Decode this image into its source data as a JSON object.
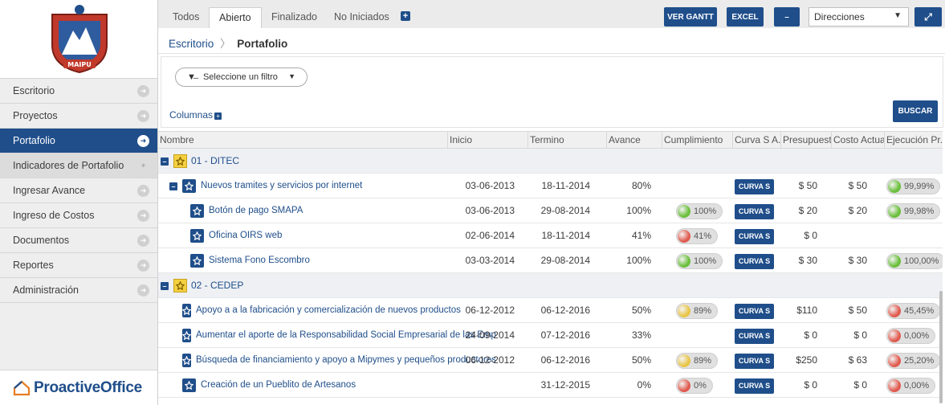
{
  "colors": {
    "primary": "#1f4e8a",
    "green": "#6abf3b",
    "red": "#e05a4e",
    "yellow": "#e8c547"
  },
  "logo": {
    "text": "MAIPU"
  },
  "sidebar": {
    "items": [
      {
        "label": "Escritorio"
      },
      {
        "label": "Proyectos"
      },
      {
        "label": "Portafolio"
      },
      {
        "label": "Indicadores de Portafolio"
      },
      {
        "label": "Ingresar Avance"
      },
      {
        "label": "Ingreso de Costos"
      },
      {
        "label": "Documentos"
      },
      {
        "label": "Reportes"
      },
      {
        "label": "Administración"
      }
    ]
  },
  "brand": {
    "name": "ProactiveOffice"
  },
  "tabs": [
    "Todos",
    "Abierto",
    "Finalizado",
    "No Iniciados"
  ],
  "toolbar": {
    "gantt": "VER GANTT",
    "excel": "EXCEL",
    "minus": "–",
    "select": "Direcciones",
    "expand": "⤢"
  },
  "breadcrumb": {
    "root": "Escritorio",
    "sep": "〉",
    "current": "Portafolio"
  },
  "filter": {
    "placeholder": "Seleccione un filtro",
    "columns": "Columnas",
    "search": "BUSCAR"
  },
  "columns": [
    "Nombre",
    "Inicio",
    "Termino",
    "Avance",
    "Cumplimiento",
    "Curva S A...",
    "Presupuesto...",
    "Costo Actual...",
    "Ejecución Pr..."
  ],
  "curvas_label": "CURVA S",
  "rows": [
    {
      "kind": "group",
      "name": "01 - DITEC"
    },
    {
      "kind": "sub",
      "name": "Nuevos tramites y servicios por internet",
      "inicio": "03-06-2013",
      "termino": "18-11-2014",
      "avance": "80%",
      "cumpl": "",
      "cumpl_color": "",
      "presup": "$ 50",
      "costo": "$ 50",
      "ejec": "99,99%",
      "ejec_color": "green"
    },
    {
      "kind": "item",
      "name": "Botón de pago SMAPA",
      "inicio": "03-06-2013",
      "termino": "29-08-2014",
      "avance": "100%",
      "cumpl": "100%",
      "cumpl_color": "green",
      "presup": "$ 20",
      "costo": "$ 20",
      "ejec": "99,98%",
      "ejec_color": "green"
    },
    {
      "kind": "item",
      "name": "Oficina OIRS web",
      "inicio": "02-06-2014",
      "termino": "18-11-2014",
      "avance": "41%",
      "cumpl": "41%",
      "cumpl_color": "red",
      "presup": "$ 0",
      "costo": "",
      "ejec": "",
      "ejec_color": ""
    },
    {
      "kind": "item",
      "name": "Sistema Fono Escombro",
      "inicio": "03-03-2014",
      "termino": "29-08-2014",
      "avance": "100%",
      "cumpl": "100%",
      "cumpl_color": "green",
      "presup": "$ 30",
      "costo": "$ 30",
      "ejec": "100,00%",
      "ejec_color": "green"
    },
    {
      "kind": "group",
      "name": "02 - CEDEP"
    },
    {
      "kind": "proj",
      "name": "Apoyo a a la fabricación y comercialización de nuevos productos",
      "inicio": "06-12-2012",
      "termino": "06-12-2016",
      "avance": "50%",
      "cumpl": "89%",
      "cumpl_color": "yellow",
      "presup": "$110",
      "costo": "$ 50",
      "ejec": "45,45%",
      "ejec_color": "red"
    },
    {
      "kind": "proj",
      "name": "Aumentar el aporte de la Responsabilidad Social Empresarial de las Emp",
      "inicio": "24-09-2014",
      "termino": "07-12-2016",
      "avance": "33%",
      "cumpl": "",
      "cumpl_color": "",
      "presup": "$ 0",
      "costo": "$ 0",
      "ejec": "0,00%",
      "ejec_color": "red"
    },
    {
      "kind": "proj",
      "name": "Búsqueda de financiamiento y apoyo a Mipymes y pequeños productores",
      "inicio": "06-12-2012",
      "termino": "06-12-2016",
      "avance": "50%",
      "cumpl": "89%",
      "cumpl_color": "yellow",
      "presup": "$250",
      "costo": "$ 63",
      "ejec": "25,20%",
      "ejec_color": "red"
    },
    {
      "kind": "proj",
      "name": "Creación de un Pueblito de Artesanos",
      "inicio": "",
      "termino": "31-12-2015",
      "avance": "0%",
      "cumpl": "0%",
      "cumpl_color": "red",
      "presup": "$ 0",
      "costo": "$ 0",
      "ejec": "0,00%",
      "ejec_color": "red"
    }
  ]
}
